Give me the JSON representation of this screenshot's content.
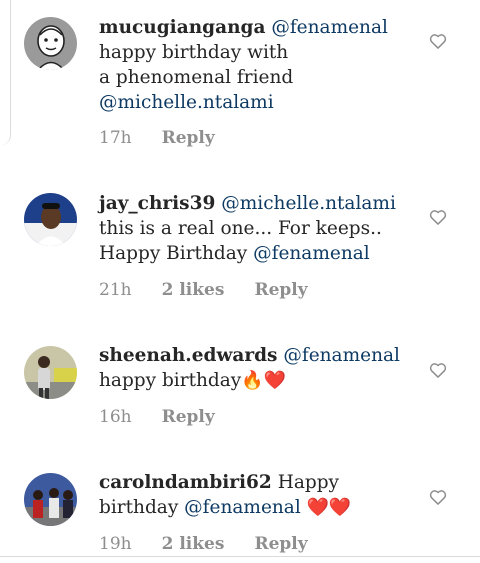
{
  "comments": [
    {
      "username": "mucugianganga",
      "lines": [
        [
          {
            "t": "mention",
            "v": "@fenamenal"
          }
        ],
        [
          {
            "t": "text",
            "v": "happy birthday with"
          }
        ],
        [
          {
            "t": "text",
            "v": "a phenomenal friend"
          }
        ],
        [
          {
            "t": "mention",
            "v": "@michelle.ntalami"
          }
        ]
      ],
      "time": "17h",
      "likes": "",
      "reply": "Reply"
    },
    {
      "username": "jay_chris39",
      "lines": [
        [
          {
            "t": "mention",
            "v": "@michelle.ntalami"
          }
        ],
        [
          {
            "t": "text",
            "v": "this is a real one... For keeps.."
          }
        ],
        [
          {
            "t": "text",
            "v": "Happy Birthday "
          },
          {
            "t": "mention",
            "v": "@fenamenal"
          }
        ]
      ],
      "time": "21h",
      "likes": "2 likes",
      "reply": "Reply"
    },
    {
      "username": "sheenah.edwards",
      "lines": [
        [
          {
            "t": "mention",
            "v": "@fenamenal"
          }
        ],
        [
          {
            "t": "text",
            "v": "happy birthday"
          },
          {
            "t": "emoji",
            "v": "🔥❤️"
          }
        ]
      ],
      "time": "16h",
      "likes": "",
      "reply": "Reply"
    },
    {
      "username": "carolndambiri62",
      "lines": [
        [
          {
            "t": "text",
            "v": "Happy"
          }
        ],
        [
          {
            "t": "text",
            "v": "birthday "
          },
          {
            "t": "mention",
            "v": "@fenamenal"
          },
          {
            "t": "emoji",
            "v": " ❤️❤️"
          }
        ]
      ],
      "time": "19h",
      "likes": "2 likes",
      "reply": "Reply"
    }
  ],
  "colors": {
    "mention": "#0e3a63",
    "meta": "#8e8e8e",
    "heart_emoji": "#e0202a"
  }
}
